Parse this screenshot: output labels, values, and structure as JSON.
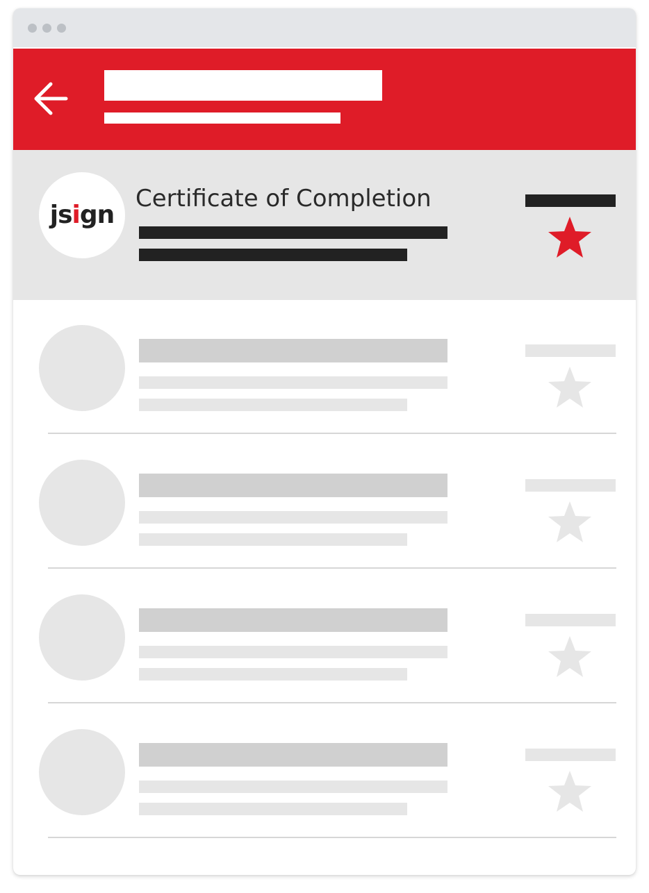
{
  "colors": {
    "brand_red": "#df1c28",
    "titlebar": "#e4e6e9",
    "highlight_bg": "#e6e6e6",
    "placeholder_dark": "#d0d0d0",
    "placeholder_light": "#e6e6e6",
    "text_dark": "#222222"
  },
  "titlebar": {
    "dots": [
      "window-dot",
      "window-dot",
      "window-dot"
    ]
  },
  "header": {
    "back_icon": "arrow-left-icon"
  },
  "highlighted_item": {
    "logo": {
      "prefix": "js",
      "highlight_letter": "i",
      "suffix": "gn"
    },
    "title": "Certificate of Completion",
    "star_icon": "star-icon",
    "starred": true
  },
  "list_items": [
    {
      "starred": false,
      "star_icon": "star-icon"
    },
    {
      "starred": false,
      "star_icon": "star-icon"
    },
    {
      "starred": false,
      "star_icon": "star-icon"
    },
    {
      "starred": false,
      "star_icon": "star-icon"
    }
  ]
}
